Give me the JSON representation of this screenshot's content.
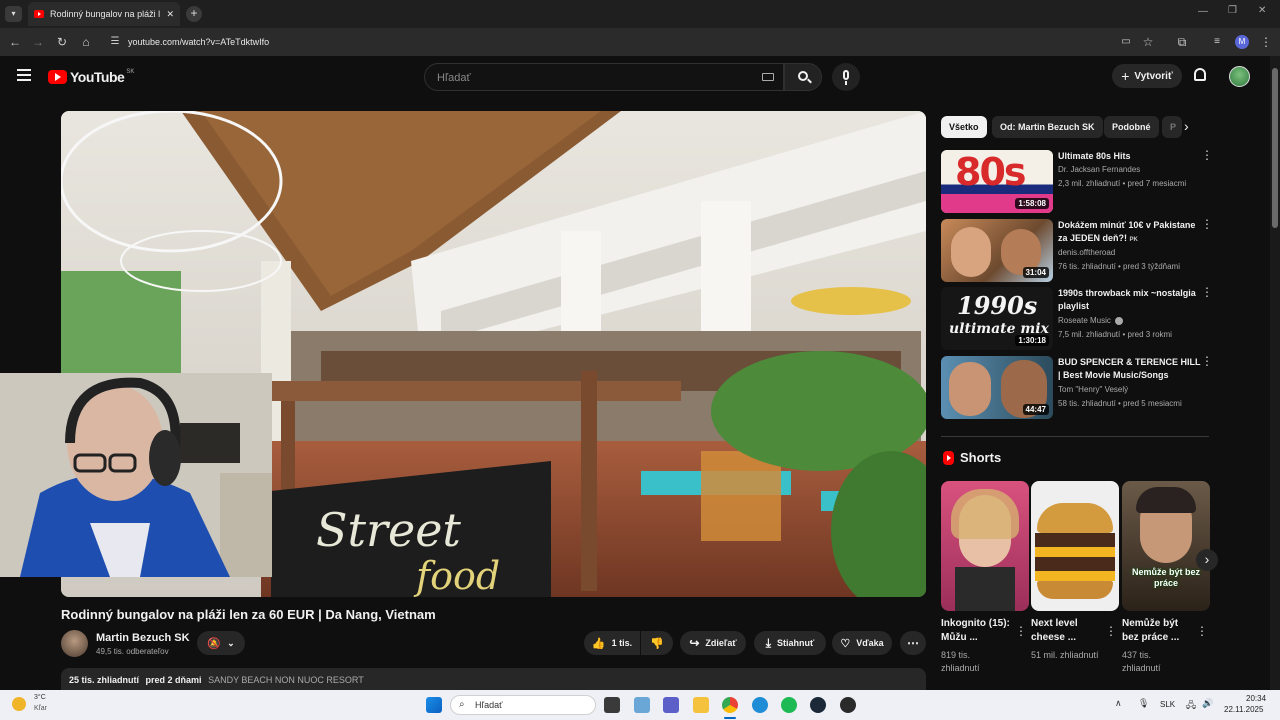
{
  "browser": {
    "tab_title": "Rodinný bungalov na pláži len za",
    "url": "youtube.com/watch?v=ATeTdktwIfo",
    "new_tab_symbol": "+",
    "close_symbol": "✕"
  },
  "yt_header": {
    "logo_text": "YouTube",
    "region": "SK",
    "search_placeholder": "Hľadať",
    "create_label": "Vytvoriť"
  },
  "video": {
    "title": "Rodinný bungalov na pláži len za 60 EUR | Da Nang, Vietnam",
    "sign_text_1": "Street",
    "sign_text_2": "food",
    "channel_name": "Martin Bezuch SK",
    "subscribers": "49,5 tis. odberateľov",
    "likes": "1 tis.",
    "share_label": "Zdieľať",
    "download_label": "Stiahnuť",
    "thanks_label": "Vďaka",
    "views": "25 tis. zhliadnutí",
    "posted": "pred 2 dňami",
    "location": "SANDY BEACH NON NUOC RESORT"
  },
  "chips": [
    "Všetko",
    "Od: Martin Bezuch SK",
    "Podobné",
    "P"
  ],
  "recommendations": [
    {
      "title": "Ultimate 80s Hits",
      "channel": "Dr. Jacksan Fernandes",
      "meta": "2,3 mil. zhliadnutí • pred 7 mesiacmi",
      "duration": "1:58:08",
      "thumb_text": "80s"
    },
    {
      "title": "Dokážem minúť 10€ v Pakistane za JEDEN deň?!",
      "badge": "PK",
      "channel": "denis.offtheroad",
      "meta": "76 tis. zhliadnutí • pred 3 týždňami",
      "duration": "31:04"
    },
    {
      "title": "1990s throwback mix ~nostalgia playlist",
      "channel": "Roseate Music",
      "meta": "7,5 mil. zhliadnutí • pred 3 rokmi",
      "duration": "1:30:18",
      "thumb_text": "1990s",
      "thumb_sub": "ultimate mix"
    },
    {
      "title": "BUD SPENCER & TERENCE HILL | Best Movie Music/Songs",
      "channel": "Tom \"Henry\" Veselý",
      "meta": "58 tis. zhliadnutí • pred 5 mesiacmi",
      "duration": "44:47"
    }
  ],
  "shorts": {
    "heading": "Shorts",
    "items": [
      {
        "title": "Inkognito (15): Můžu ...",
        "views": "819 tis. zhliadnutí"
      },
      {
        "title": "Next level cheese ...",
        "views": "51 mil. zhliadnutí"
      },
      {
        "title": "Nemůže být bez práce ...",
        "views": "437 tis. zhliadnutí",
        "overlay": "Nemůže být bez práce"
      }
    ]
  },
  "taskbar": {
    "weather_temp": "3°C",
    "weather_desc": "Kľar",
    "search_label": "Hľadať",
    "language": "SLK",
    "time": "20:34",
    "date": "22.11.2025"
  },
  "colors": {
    "accent_red": "#ff0000",
    "background": "#0f0f0f",
    "chip_bg": "#272727"
  }
}
